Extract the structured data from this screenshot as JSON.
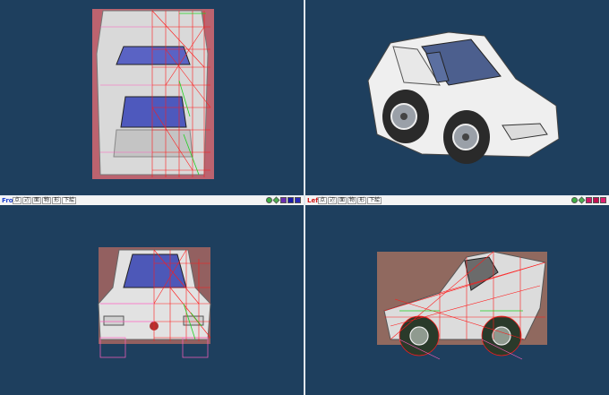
{
  "viewports": {
    "front": {
      "title": "Front",
      "tools": [
        "点",
        "辺",
        "面",
        "物",
        "形",
        "下絵"
      ],
      "swatch_colors": [
        "#3cb043",
        "#4caf50",
        "#6a2fb0",
        "#1a1aa8",
        "#2a2ab8"
      ]
    },
    "left": {
      "title": "Left",
      "tools": [
        "点",
        "辺",
        "面",
        "物",
        "形",
        "下絵"
      ],
      "swatch_colors": [
        "#3cb043",
        "#4caf50",
        "#d01868",
        "#c01050",
        "#e02070"
      ]
    }
  },
  "colors": {
    "background": "#1e3f5e",
    "wire_red": "#ff1010",
    "wire_green": "#20d020",
    "wire_pink": "#ff60c0"
  }
}
